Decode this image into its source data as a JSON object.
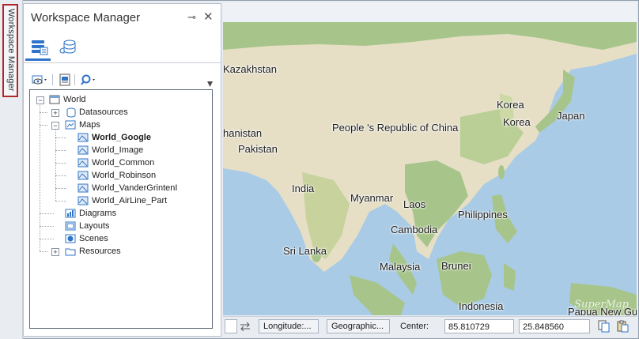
{
  "side_tab": {
    "label": "Workspace Manager"
  },
  "panel": {
    "title": "Workspace Manager",
    "pin_glyph": "⊸",
    "close_glyph": "✕"
  },
  "tree": {
    "root": "World",
    "datasources": "Datasources",
    "maps": "Maps",
    "map_items": [
      "World_Google",
      "World_Image",
      "World_Common",
      "World_Robinson",
      "World_VanderGrintenI",
      "World_AirLine_Part"
    ],
    "selected": "World_Google",
    "diagrams": "Diagrams",
    "layouts": "Layouts",
    "scenes": "Scenes",
    "resources": "Resources"
  },
  "map": {
    "labels": {
      "kazakhstan": "Kazakhstan",
      "afghanistan": "hanistan",
      "pakistan": "Pakistan",
      "china": "People 's Republic of China",
      "korea1": "Korea",
      "korea2": "Korea",
      "japan": "Japan",
      "india": "India",
      "myanmar": "Myanmar",
      "laos": "Laos",
      "philippines": "Philippines",
      "cambodia": "Cambodia",
      "srilanka": "Sri Lanka",
      "malaysia": "Malaysia",
      "brunei": "Brunei",
      "indonesia": "Indonesia",
      "papua": "Papua New Guinea"
    },
    "watermark": "SuperMap",
    "colors": {
      "sea": "#a9cbe6",
      "land": "#e6dfc6",
      "forest": "#a7c58a"
    }
  },
  "status": {
    "longitude_btn": "Longitude:...",
    "projection_btn": "Geographic...",
    "center_label": "Center:",
    "center_x": "85.810729",
    "center_y": "25.848560"
  }
}
